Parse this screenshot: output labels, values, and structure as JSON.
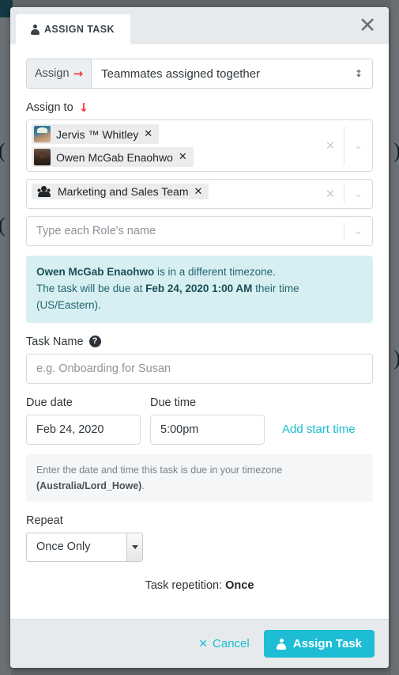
{
  "modal": {
    "tab_label": "ASSIGN TASK",
    "tab_icon": "person-icon",
    "close_icon": "close-icon"
  },
  "assign_mode": {
    "addon_label": "Assign",
    "addon_arrow": "→",
    "selected": "Teammates assigned together",
    "caret": "↕"
  },
  "assign_to": {
    "label": "Assign to",
    "arrow": "↓",
    "members": [
      {
        "name": "Jervis ™ Whitley",
        "remove": "✕",
        "avatar": "avatar-jervis"
      },
      {
        "name": "Owen McGab Enaohwo",
        "remove": "✕",
        "avatar": "avatar-owen"
      }
    ],
    "teams": [
      {
        "name": "Marketing and Sales Team",
        "remove": "✕",
        "icon": "group-icon"
      }
    ],
    "roles_placeholder": "Type each Role's name",
    "clear_icon": "✕",
    "caret_icon": "⌄"
  },
  "timezone_alert": {
    "line1_bold": "Owen McGab Enaohwo",
    "line1_rest": " is in a different timezone.",
    "line2_pre": "The task will be due at ",
    "line2_bold": "Feb 24, 2020 1:00 AM",
    "line2_post": " their time (US/Eastern).",
    "bg_color": "#d7eff2"
  },
  "task_name": {
    "label": "Task Name",
    "help_icon": "?",
    "placeholder": "e.g. Onboarding for Susan",
    "value": ""
  },
  "due": {
    "date_label": "Due date",
    "time_label": "Due time",
    "date_value": "Feb 24, 2020",
    "time_value": "5:00pm",
    "add_start_time": "Add start time",
    "hint_pre": "Enter the date and time this task is due in your timezone ",
    "hint_bold": "(Australia/Lord_Howe)",
    "hint_post": "."
  },
  "repeat": {
    "label": "Repeat",
    "selected": "Once Only",
    "repetition_pre": "Task repetition: ",
    "repetition_value": "Once"
  },
  "footer": {
    "cancel_icon": "✕",
    "cancel_label": "Cancel",
    "submit_icon": "person-icon",
    "submit_label": "Assign Task",
    "accent_color": "#1dbdd6"
  },
  "background": {
    "left_glyph": "(",
    "right_glyph": ")",
    "left_glyph2": "(",
    "right_glyph2": ")"
  }
}
